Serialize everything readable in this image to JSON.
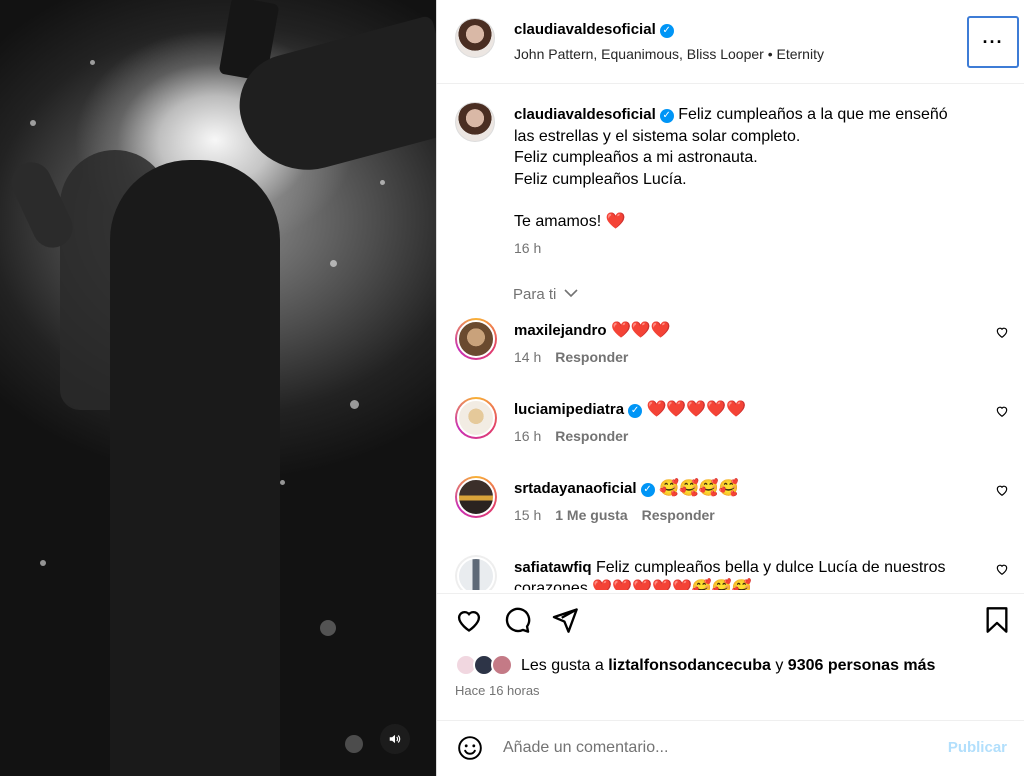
{
  "media": {
    "sound_icon": "speaker-icon"
  },
  "header": {
    "username": "claudiavaldesoficial",
    "audio": "John Pattern, Equanimous, Bliss Looper • Eternity",
    "more_label": "···"
  },
  "caption": {
    "username": "claudiavaldesoficial",
    "lines": [
      "Feliz cumpleaños a la que me enseñó",
      "las estrellas y el sistema solar completo.",
      "Feliz cumpleaños a mi astronauta.",
      "Feliz cumpleaños Lucía.",
      "",
      "Te amamos! ❤️"
    ],
    "time": "16 h"
  },
  "filter": {
    "label": "Para ti",
    "icon": "chevron-down-icon"
  },
  "comments": [
    {
      "username": "maxilejandro",
      "verified": false,
      "text": "❤️❤️❤️",
      "time": "14 h",
      "likes": "",
      "reply": "Responder"
    },
    {
      "username": "luciamipediatra",
      "verified": true,
      "text": "❤️❤️❤️❤️❤️",
      "time": "16 h",
      "likes": "",
      "reply": "Responder"
    },
    {
      "username": "srtadayanaoficial",
      "verified": true,
      "text": "🥰🥰🥰🥰",
      "time": "15 h",
      "likes": "1 Me gusta",
      "reply": "Responder"
    },
    {
      "username": "safiatawfiq",
      "verified": false,
      "text": "Feliz cumpleaños bella y dulce Lucía de nuestros corazones ❤️❤️❤️❤️❤️🥰🥰🥰",
      "time": "",
      "likes": "",
      "reply": ""
    }
  ],
  "actions": {
    "like_icon": "heart-icon",
    "comment_icon": "comment-icon",
    "share_icon": "send-icon",
    "save_icon": "bookmark-icon"
  },
  "likes": {
    "prefix": "Les gusta a",
    "user": "liztalfonsodancecuba",
    "connector": "y",
    "count": "9306 personas más"
  },
  "posted": "Hace 16 horas",
  "add_comment": {
    "placeholder": "Añade un comentario...",
    "publish": "Publicar",
    "emoji_icon": "smiley-icon"
  },
  "colors": {
    "link_blue": "#0095f6",
    "publish_disabled": "#b2dffc",
    "muted": "#737373"
  }
}
